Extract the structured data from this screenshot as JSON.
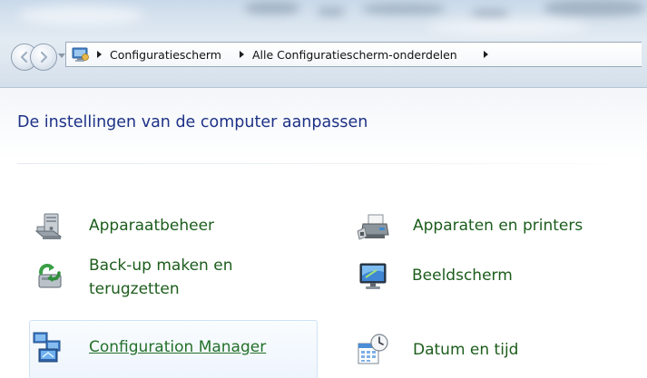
{
  "window": {
    "back_icon": "back-arrow-icon",
    "forward_icon": "forward-arrow-icon"
  },
  "address_bar": {
    "location_icon": "control-panel-icon",
    "breadcrumbs": [
      {
        "label": "Configuratiescherm"
      },
      {
        "label": "Alle Configuratiescherm-onderdelen"
      }
    ]
  },
  "page": {
    "title": "De instellingen van de computer aanpassen"
  },
  "items": [
    {
      "label": "Apparaatbeheer",
      "icon": "device-manager-icon"
    },
    {
      "label": "Apparaten en printers",
      "icon": "devices-printers-icon"
    },
    {
      "label_line1": "Back-up maken en",
      "label_line2": "terugzetten",
      "icon": "backup-restore-icon"
    },
    {
      "label": "Beeldscherm",
      "icon": "display-icon"
    },
    {
      "label": "Configuration Manager",
      "icon": "configuration-manager-icon",
      "hovered": true
    },
    {
      "label": "Datum en tijd",
      "icon": "date-time-icon"
    }
  ],
  "colors": {
    "title_blue": "#1e3287",
    "link_green": "#1c5d1c",
    "hover_border": "#cfe2f4"
  }
}
